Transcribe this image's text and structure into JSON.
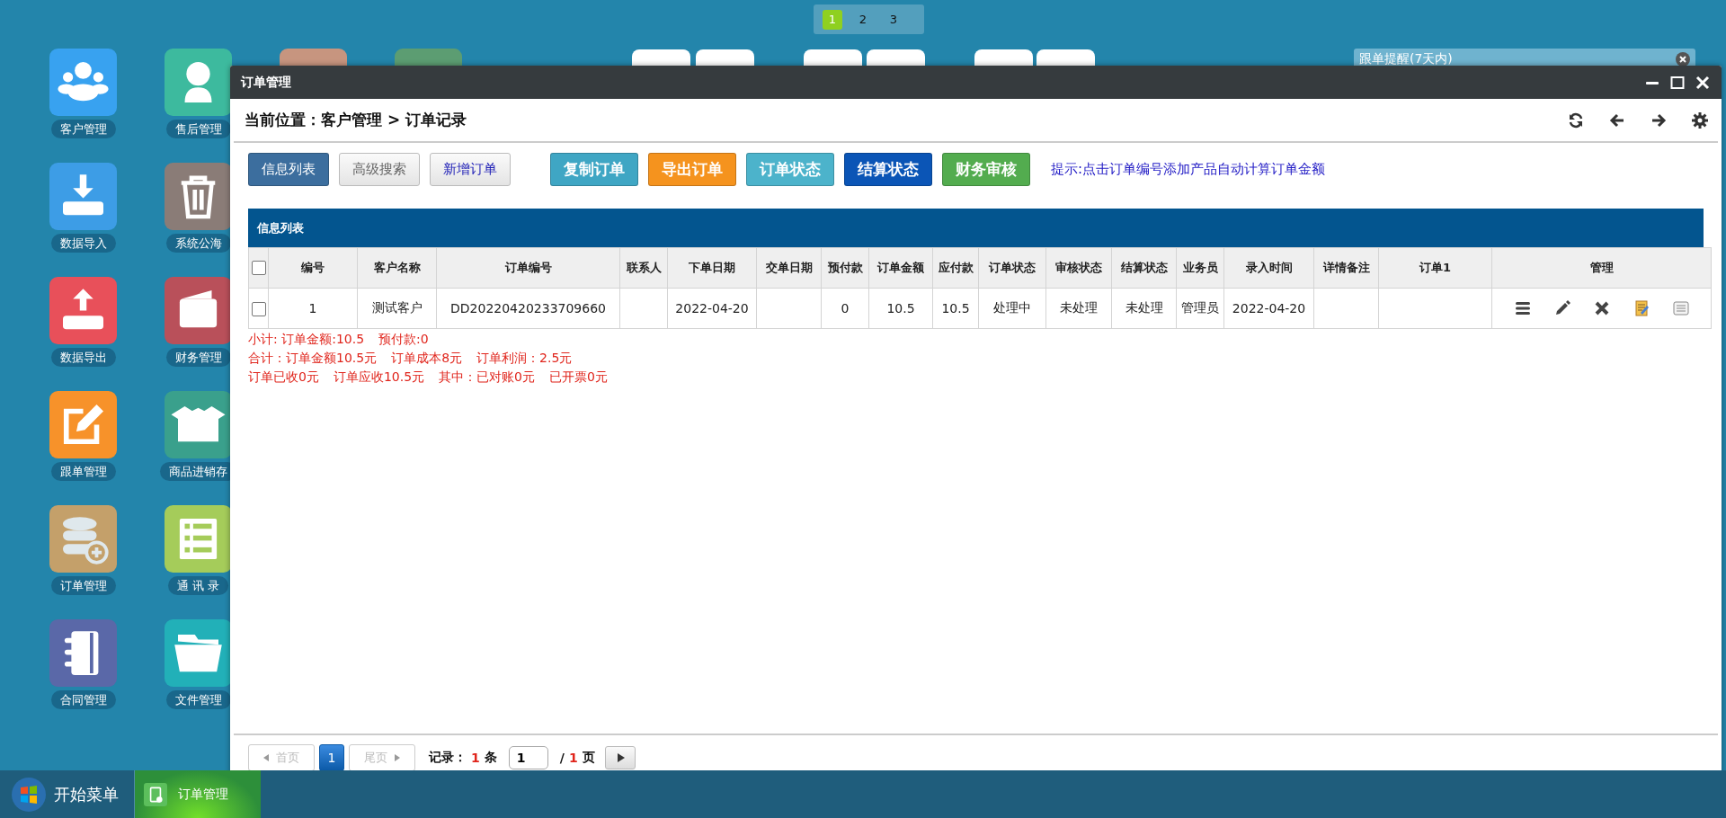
{
  "desktop": {
    "page_tabs": [
      {
        "label": "1",
        "selected": true
      },
      {
        "label": "2",
        "selected": false
      },
      {
        "label": "3",
        "selected": false
      }
    ],
    "icons": [
      {
        "label": "客户管理",
        "kind": "users",
        "color": "#38a2f0"
      },
      {
        "label": "数据导入",
        "kind": "import",
        "color": "#3d9de6"
      },
      {
        "label": "数据导出",
        "kind": "export",
        "color": "#e8505a"
      },
      {
        "label": "跟单管理",
        "kind": "edit",
        "color": "#f7922a"
      },
      {
        "label": "订单管理",
        "kind": "database",
        "color": "#c4a06a"
      },
      {
        "label": "合同管理",
        "kind": "notebook",
        "color": "#5a68a8"
      },
      {
        "label": "售后管理",
        "kind": "agent",
        "color": "#3dba9e"
      },
      {
        "label": "系统公海",
        "kind": "trash",
        "color": "#8a7c77"
      },
      {
        "label": "财务管理",
        "kind": "wallet",
        "color": "#b9505a"
      },
      {
        "label": "商品进销存",
        "kind": "box",
        "color": "#3aa08c"
      },
      {
        "label": "通 讯 录",
        "kind": "list",
        "color": "#a5cc5a"
      },
      {
        "label": "文件管理",
        "kind": "folder",
        "color": "#22b0b8"
      }
    ],
    "reminder": {
      "title": "跟单提醒(7天内)"
    }
  },
  "window": {
    "title": "订单管理",
    "breadcrumb": "当前位置：客户管理 > 订单记录",
    "buttons_left": [
      {
        "label": "信息列表",
        "kind": "solid",
        "color": "#3c6e9e"
      },
      {
        "label": "高级搜索",
        "kind": "plain",
        "color": "#666666"
      },
      {
        "label": "新增订单",
        "kind": "plain",
        "color": "#1b1bb5"
      }
    ],
    "buttons_right": [
      {
        "label": "复制订单",
        "kind": "solid",
        "color": "#3fa6c4"
      },
      {
        "label": "导出订单",
        "kind": "solid",
        "color": "#f5931e"
      },
      {
        "label": "订单状态",
        "kind": "solid",
        "color": "#4cb3cb"
      },
      {
        "label": "结算状态",
        "kind": "solid",
        "color": "#0b55b6"
      },
      {
        "label": "财务审核",
        "kind": "solid",
        "color": "#53ac4f"
      }
    ],
    "hint": "提示:点击订单编号添加产品自动计算订单金额",
    "table": {
      "title": "信息列表",
      "select_all_checked": false,
      "columns": [
        "编号",
        "客户名称",
        "订单编号",
        "联系人",
        "下单日期",
        "交单日期",
        "预付款",
        "订单金额",
        "应付款",
        "订单状态",
        "审核状态",
        "结算状态",
        "业务员",
        "录入时间",
        "详情备注",
        "订单1",
        "管理"
      ],
      "rows": [
        {
          "checked": false,
          "cells": [
            "1",
            "测试客户",
            "DD20220420233709660",
            null,
            "2022-04-20",
            null,
            "0",
            "10.5",
            "10.5",
            "处理中",
            "未处理",
            "未处理",
            "管理员",
            "2022-04-20",
            null,
            null
          ]
        }
      ]
    },
    "summary": [
      [
        "小计:  订单金额:10.5",
        "预付款:0"
      ],
      [
        "合计：订单金额10.5元",
        "订单成本8元",
        "订单利润：2.5元"
      ],
      [
        "订单已收0元",
        "订单应收10.5元",
        "其中：已对账0元",
        "已开票0元"
      ]
    ],
    "pager": {
      "first": "首页",
      "last": "尾页",
      "first_disabled": true,
      "last_disabled": true,
      "pages": [
        {
          "label": "1",
          "selected": true
        }
      ],
      "record_label": "记录：",
      "record_count": "1",
      "record_unit": "条",
      "page_value": "1",
      "page_sep": "/",
      "page_total": "1",
      "page_unit": "页"
    }
  },
  "taskbar": {
    "start": "开始菜单",
    "tasks": [
      {
        "label": "订单管理",
        "selected": true
      }
    ]
  }
}
